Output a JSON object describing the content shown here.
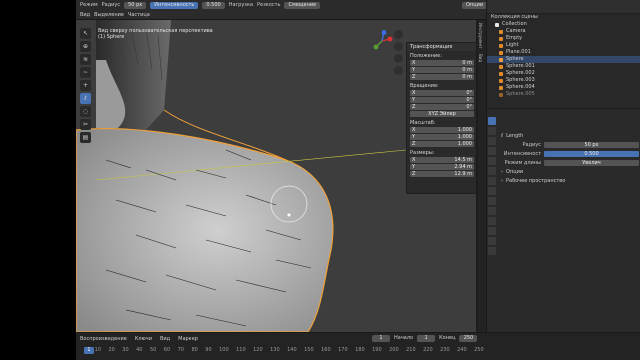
{
  "header": {
    "row1": [
      "Режим",
      "Радиус",
      "50 px",
      "Интенсивность",
      "0.500",
      "Нагрузка",
      "Резкость",
      "Смещение"
    ],
    "row2": [
      "Вид",
      "Выделение",
      "Частица"
    ],
    "right_options": "Опции"
  },
  "viewport": {
    "line1": "Вид сверху пользовательская перспектива",
    "line2": "(1) Sphere"
  },
  "npanel": {
    "title": "Трансформация",
    "location_label": "Положение:",
    "location": [
      {
        "k": "X",
        "v": "0 m"
      },
      {
        "k": "Y",
        "v": "0 m"
      },
      {
        "k": "Z",
        "v": "0 m"
      }
    ],
    "rotation_label": "Вращение:",
    "rotation": [
      {
        "k": "X",
        "v": "0°"
      },
      {
        "k": "Y",
        "v": "0°"
      },
      {
        "k": "Z",
        "v": "0°"
      }
    ],
    "rotation_mode": "XYZ Эйлер",
    "scale_label": "Масштаб:",
    "scale": [
      {
        "k": "X",
        "v": "1.000"
      },
      {
        "k": "Y",
        "v": "1.000"
      },
      {
        "k": "Z",
        "v": "1.000"
      }
    ],
    "dims_label": "Размеры:",
    "dims": [
      {
        "k": "X",
        "v": "14.5 m"
      },
      {
        "k": "Y",
        "v": "2.94 m"
      },
      {
        "k": "Z",
        "v": "12.9 m"
      }
    ]
  },
  "tabs": [
    "Инструмент",
    "Вид"
  ],
  "outliner": {
    "title": "Коллекция сцены",
    "items": [
      "Collection",
      "Camera",
      "Empty",
      "Light",
      "Plane.001",
      "Sphere",
      "Sphere.001",
      "Sphere.002",
      "Sphere.003",
      "Sphere.004",
      "Sphere.005"
    ]
  },
  "properties": {
    "brush_name": "Length",
    "rows": [
      {
        "k": "Радиус",
        "v": "50 px"
      },
      {
        "k": "Интенсивност",
        "v": "0.500"
      },
      {
        "k": "Режим длины",
        "v": "Увелич"
      }
    ],
    "options": "Опции",
    "workspace": "Рабочее пространство"
  },
  "timeline": {
    "items": [
      "Воспроизведение",
      "Ключи",
      "Вид",
      "Маркер"
    ],
    "current": "1",
    "start_label": "Начало",
    "start": "1",
    "end_label": "Конец",
    "end": "250",
    "ruler": [
      "1",
      "10",
      "20",
      "30",
      "40",
      "50",
      "60",
      "70",
      "80",
      "90",
      "100",
      "110",
      "120",
      "130",
      "140",
      "150",
      "160",
      "170",
      "180",
      "190",
      "200",
      "210",
      "220",
      "230",
      "240",
      "250"
    ]
  }
}
